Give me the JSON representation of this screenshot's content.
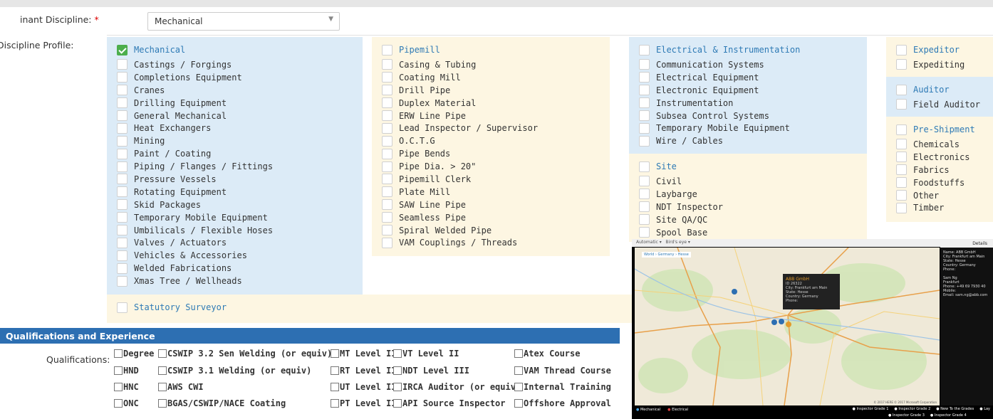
{
  "header": {
    "dominant_label": "inant Discipline:",
    "required_mark": "*",
    "select_value": "Mechanical",
    "profile_label": "Discipline Profile:"
  },
  "panels": {
    "mechanical": {
      "head": "Mechanical",
      "checked": true,
      "items": [
        "Castings / Forgings",
        "Completions Equipment",
        "Cranes",
        "Drilling Equipment",
        "General Mechanical",
        "Heat Exchangers",
        "Mining",
        "Paint / Coating",
        "Piping / Flanges / Fittings",
        "Pressure Vessels",
        "Rotating Equipment",
        "Skid Packages",
        "Temporary Mobile Equipment",
        "Umbilicals / Flexible Hoses",
        "Valves / Actuators",
        "Vehicles & Accessories",
        "Welded Fabrications",
        "Xmas Tree / Wellheads"
      ]
    },
    "pipemill": {
      "head": "Pipemill",
      "items": [
        "Casing & Tubing",
        "Coating Mill",
        "Drill Pipe",
        "Duplex Material",
        "ERW Line Pipe",
        "Lead Inspector / Supervisor",
        "O.C.T.G",
        "Pipe Bends",
        "Pipe Dia. > 20\"",
        "Pipemill Clerk",
        "Plate Mill",
        "SAW Line Pipe",
        "Seamless Pipe",
        "Spiral Welded Pipe",
        "VAM Couplings / Threads"
      ]
    },
    "electrical": {
      "head": "Electrical & Instrumentation",
      "items": [
        "Communication Systems",
        "Electrical Equipment",
        "Electronic Equipment",
        "Instrumentation",
        "Subsea Control Systems",
        "Temporary Mobile Equipment",
        "Wire / Cables"
      ]
    },
    "site": {
      "head": "Site",
      "items": [
        "Civil",
        "Laybarge",
        "NDT Inspector",
        "Site QA/QC",
        "Spool Base"
      ]
    },
    "expeditor": {
      "head": "Expeditor",
      "items": [
        "Expediting"
      ]
    },
    "auditor": {
      "head": "Auditor",
      "items": [
        "Field Auditor"
      ]
    },
    "preshipment": {
      "head": "Pre-Shipment",
      "items": [
        "Chemicals",
        "Electronics",
        "Fabrics",
        "Foodstuffs",
        "Other",
        "Timber"
      ]
    },
    "statutory": {
      "head": "Statutory Surveyor"
    }
  },
  "qualifications": {
    "section_title": "Qualifications and Experience",
    "label": "Qualifications:",
    "col1": [
      "Degree",
      "HND",
      "HNC",
      "ONC"
    ],
    "col2": [
      "CSWIP 3.2 Sen Welding (or equiv)",
      "CSWIP 3.1 Welding (or equiv)",
      "AWS CWI",
      "BGAS/CSWIP/NACE Coating"
    ],
    "col3": [
      "MT Level II",
      "RT Level II",
      "UT Level II",
      "PT Level II"
    ],
    "col4": [
      "VT Level II",
      "NDT Level III",
      "IRCA Auditor (or equiv)",
      "API Source Inspector"
    ],
    "col5": [
      "Atex Course",
      "VAM Thread Course",
      "Internal Training",
      "Offshore Approval"
    ]
  },
  "map": {
    "tabs": [
      "Automatic",
      "Bird's eye"
    ],
    "breadcrumb": "World › Germany › Hesse",
    "details_title": "Details",
    "details_text": "Name: ABB GmbH\nCity: Frankfurt am Main\nState: Hesse\nCountry: Germany\nPhone:\n\nSam Ng\nFrankfurt\nPhone: +49 69 7930 40\nMobile:\nEmail: sam.ng@abb.com",
    "popup_title": "ABB GmbH",
    "popup_text": "ID 26322\nCity: Frankfurt am Main\nState: Hesse\nCountry: Germany\nPhone:",
    "legend_left": [
      "Mechanical",
      "Electrical"
    ],
    "legend_right": [
      "Inspector Grade 1",
      "Inspector Grade 2",
      "New To the Grades",
      "Lay"
    ],
    "legend_right2": [
      "Inspector Grade 3",
      "Inspector Grade 4"
    ],
    "copyright": "© 2017 HERE  © 2017 Microsoft Corporation"
  },
  "colors": {
    "panel_blue": "#dcebf7",
    "panel_cream": "#fdf6e2",
    "link": "#2e7ab5",
    "section_bar": "#2d6fb2",
    "check_green": "#4cae4c"
  }
}
